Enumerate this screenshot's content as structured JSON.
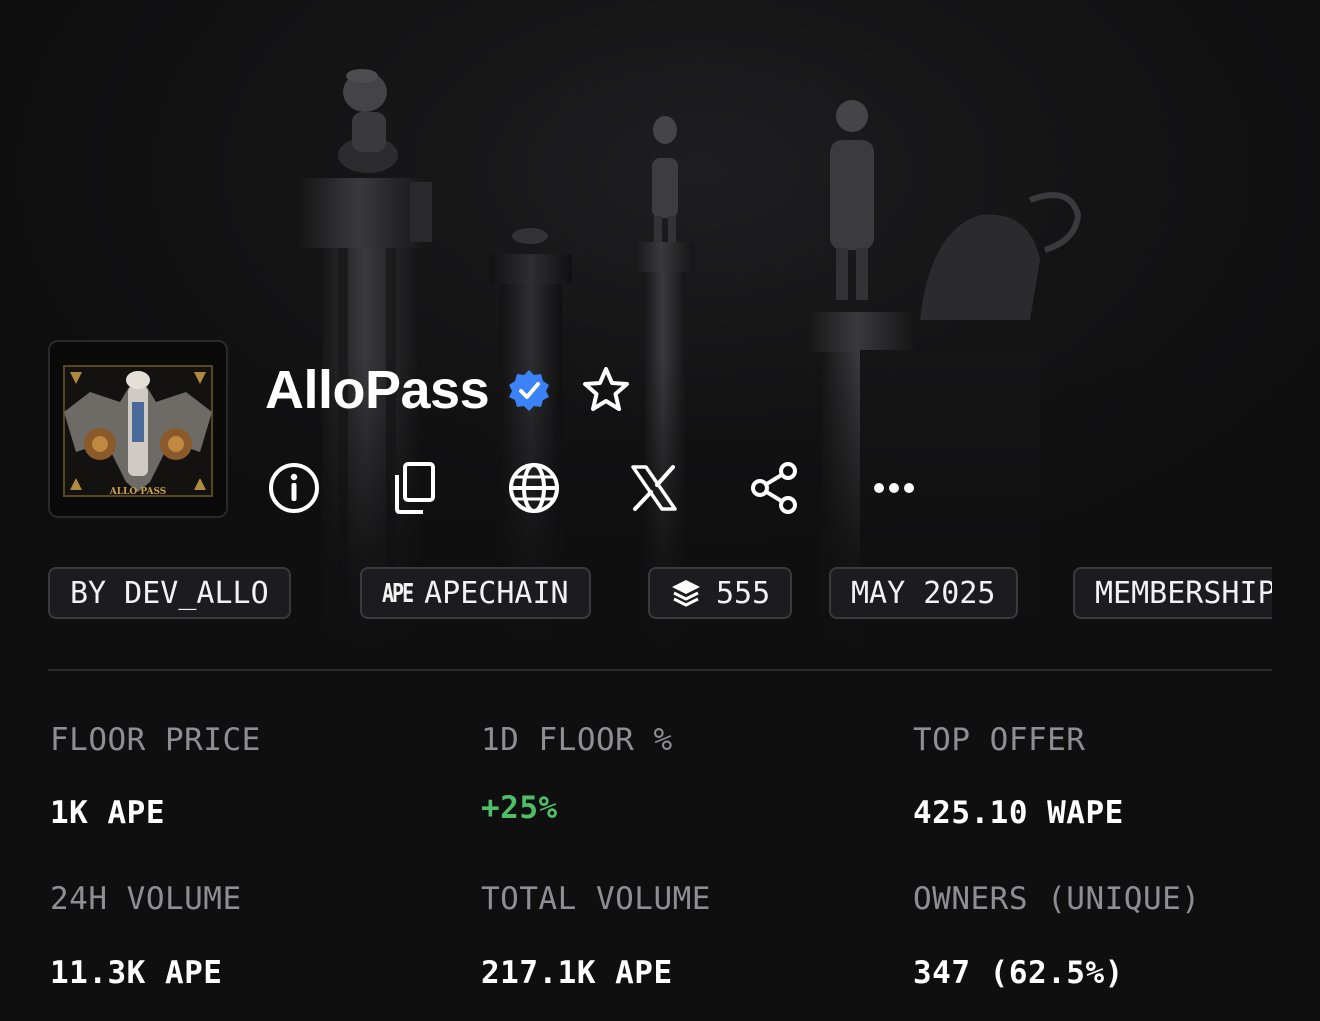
{
  "collection": {
    "name": "AlloPass",
    "verified": true,
    "avatar_caption": "ALLO PASS"
  },
  "actions": [
    {
      "name": "info-icon"
    },
    {
      "name": "copy-icon"
    },
    {
      "name": "globe-icon"
    },
    {
      "name": "x-icon"
    },
    {
      "name": "share-icon"
    },
    {
      "name": "more-icon"
    }
  ],
  "chips": {
    "creator": "BY DEV_ALLO",
    "chain_mark": "APE",
    "chain": "APECHAIN",
    "items": "555",
    "date": "MAY 2025",
    "category": "MEMBERSHIP"
  },
  "stats": {
    "floor_price": {
      "label": "FLOOR PRICE",
      "value": "1K APE"
    },
    "floor_change": {
      "label": "1D FLOOR %",
      "value": "+25%"
    },
    "top_offer": {
      "label": "TOP OFFER",
      "value": "425.10 WAPE"
    },
    "volume_24h": {
      "label": "24H VOLUME",
      "value": "11.3K APE"
    },
    "total_volume": {
      "label": "TOTAL VOLUME",
      "value": "217.1K APE"
    },
    "owners": {
      "label": "OWNERS (UNIQUE)",
      "value": "347 (62.5%)"
    }
  },
  "colors": {
    "background": "#0f0f10",
    "verified_blue": "#3b82f6",
    "positive_green": "#4fbf67",
    "label_gray": "#8e8e93"
  }
}
